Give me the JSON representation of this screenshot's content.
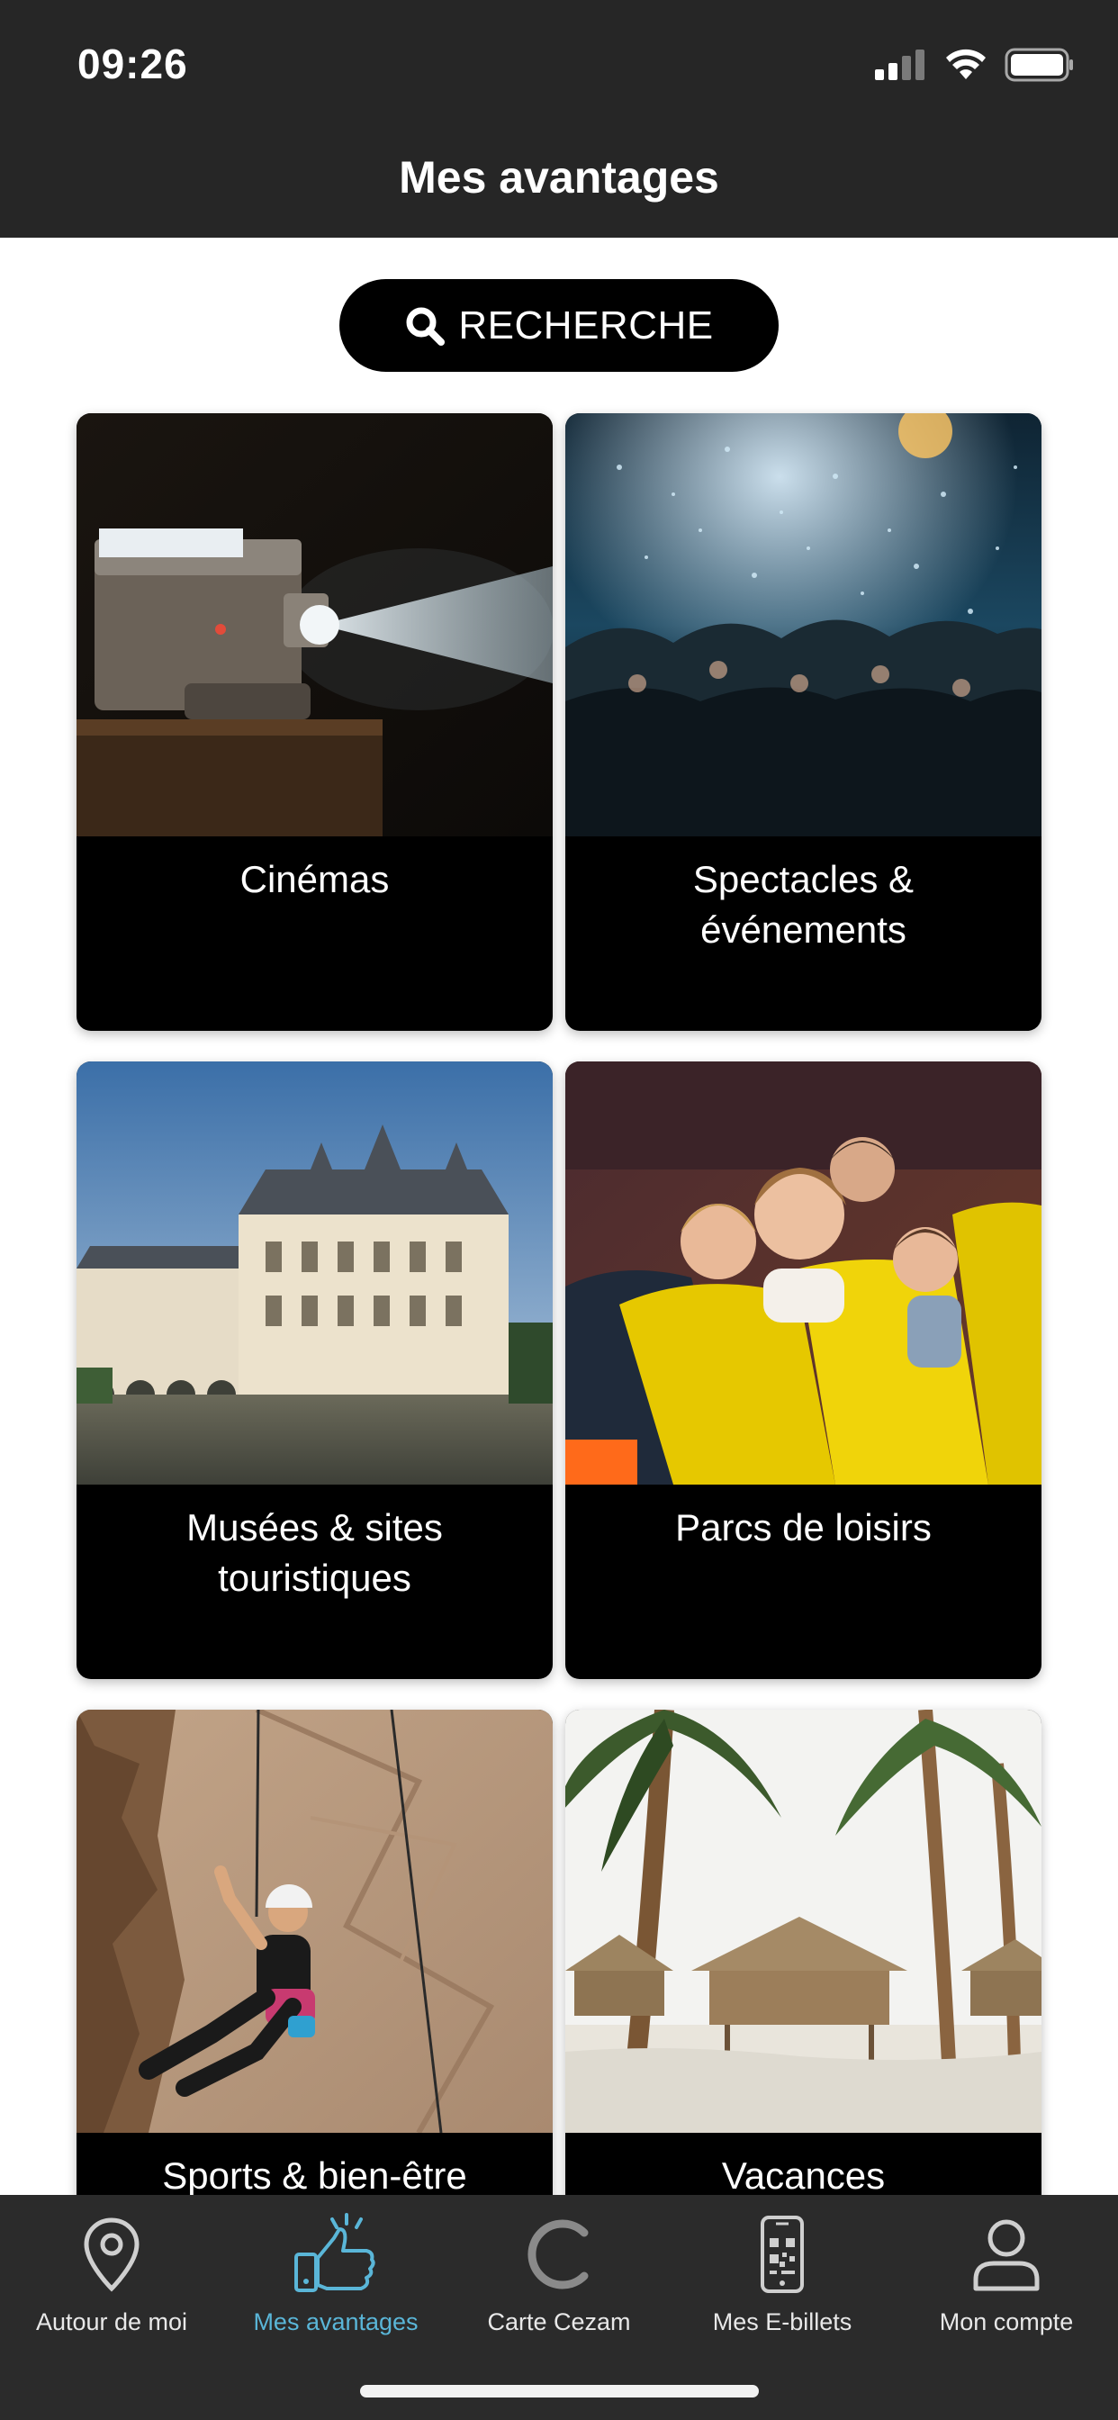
{
  "status_bar": {
    "time": "09:26",
    "icons": [
      "signal-icon",
      "wifi-icon",
      "battery-icon"
    ]
  },
  "header": {
    "title": "Mes avantages"
  },
  "search": {
    "label": "RECHERCHE",
    "icon": "search-icon"
  },
  "categories": [
    {
      "label": "Cinémas",
      "image": "film-projector-photo"
    },
    {
      "label": "Spectacles & événements",
      "image": "concert-crowd-photo"
    },
    {
      "label": "Musées & sites touristiques",
      "image": "chateau-photo"
    },
    {
      "label": "Parcs de loisirs",
      "image": "roller-coaster-photo"
    },
    {
      "label": "Sports & bien-être",
      "image": "climber-photo"
    },
    {
      "label": "Vacances",
      "image": "beach-huts-photo"
    }
  ],
  "tabbar": {
    "active_color": "#5ab6d8",
    "items": [
      {
        "label": "Autour de moi",
        "icon": "location-pin-icon"
      },
      {
        "label": "Mes avantages",
        "icon": "thumbs-up-icon",
        "active": true
      },
      {
        "label": "Carte Cezam",
        "icon": "cezam-c-icon"
      },
      {
        "label": "Mes E-billets",
        "icon": "phone-qr-icon"
      },
      {
        "label": "Mon compte",
        "icon": "user-icon"
      }
    ]
  }
}
